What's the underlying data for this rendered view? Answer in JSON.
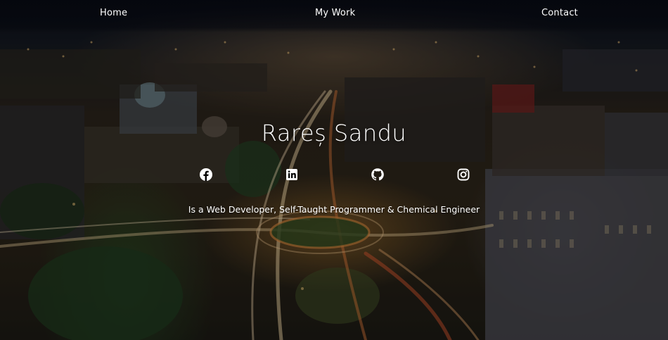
{
  "nav": {
    "home_label": "Home",
    "work_label": "My Work",
    "contact_label": "Contact"
  },
  "hero": {
    "name": "Rareș Sandu",
    "tagline": "Is a Web Developer, Self-Taught Programmer & Chemical Engineer",
    "background": "night-city-aerial-photo"
  },
  "social": [
    {
      "icon": "facebook-icon"
    },
    {
      "icon": "linkedin-icon"
    },
    {
      "icon": "github-icon"
    },
    {
      "icon": "instagram-icon"
    }
  ],
  "colors": {
    "text": "#ffffff",
    "nav_background": "#05070e"
  }
}
